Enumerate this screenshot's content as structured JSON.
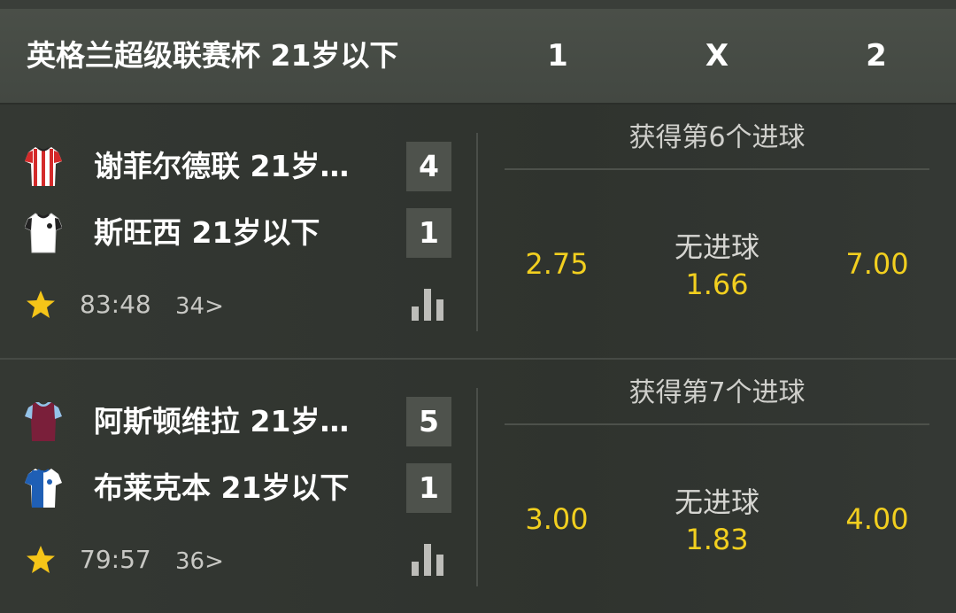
{
  "header": {
    "league": "英格兰超级联赛杯 21岁以下",
    "col_1": "1",
    "col_x": "X",
    "col_2": "2"
  },
  "matches": [
    {
      "home": {
        "name": "谢菲尔德联 21岁…",
        "score": "4",
        "shirt_colors": [
          "#d42a2a",
          "#ffffff"
        ]
      },
      "away": {
        "name": "斯旺西 21岁以下",
        "score": "1",
        "shirt_colors": [
          "#ffffff",
          "#222222"
        ]
      },
      "time": "83:48",
      "markets_link": "34>",
      "market_title": "获得第6个进球",
      "odds": {
        "home": "2.75",
        "draw_label": "无进球",
        "draw": "1.66",
        "away": "7.00"
      }
    },
    {
      "home": {
        "name": "阿斯顿维拉 21岁…",
        "score": "5",
        "shirt_colors": [
          "#7a1f3a",
          "#93c3e8"
        ]
      },
      "away": {
        "name": "布莱克本 21岁以下",
        "score": "1",
        "shirt_colors": [
          "#1f5fb5",
          "#ffffff"
        ]
      },
      "time": "79:57",
      "markets_link": "36>",
      "market_title": "获得第7个进球",
      "odds": {
        "home": "3.00",
        "draw_label": "无进球",
        "draw": "1.83",
        "away": "4.00"
      }
    }
  ],
  "colors": {
    "odds": "#f2cf1f",
    "star": "#f5c518",
    "score_bg": "#4e524c"
  },
  "icons": [
    "shirt-icon",
    "favorite-star-icon",
    "stats-bars-icon"
  ]
}
